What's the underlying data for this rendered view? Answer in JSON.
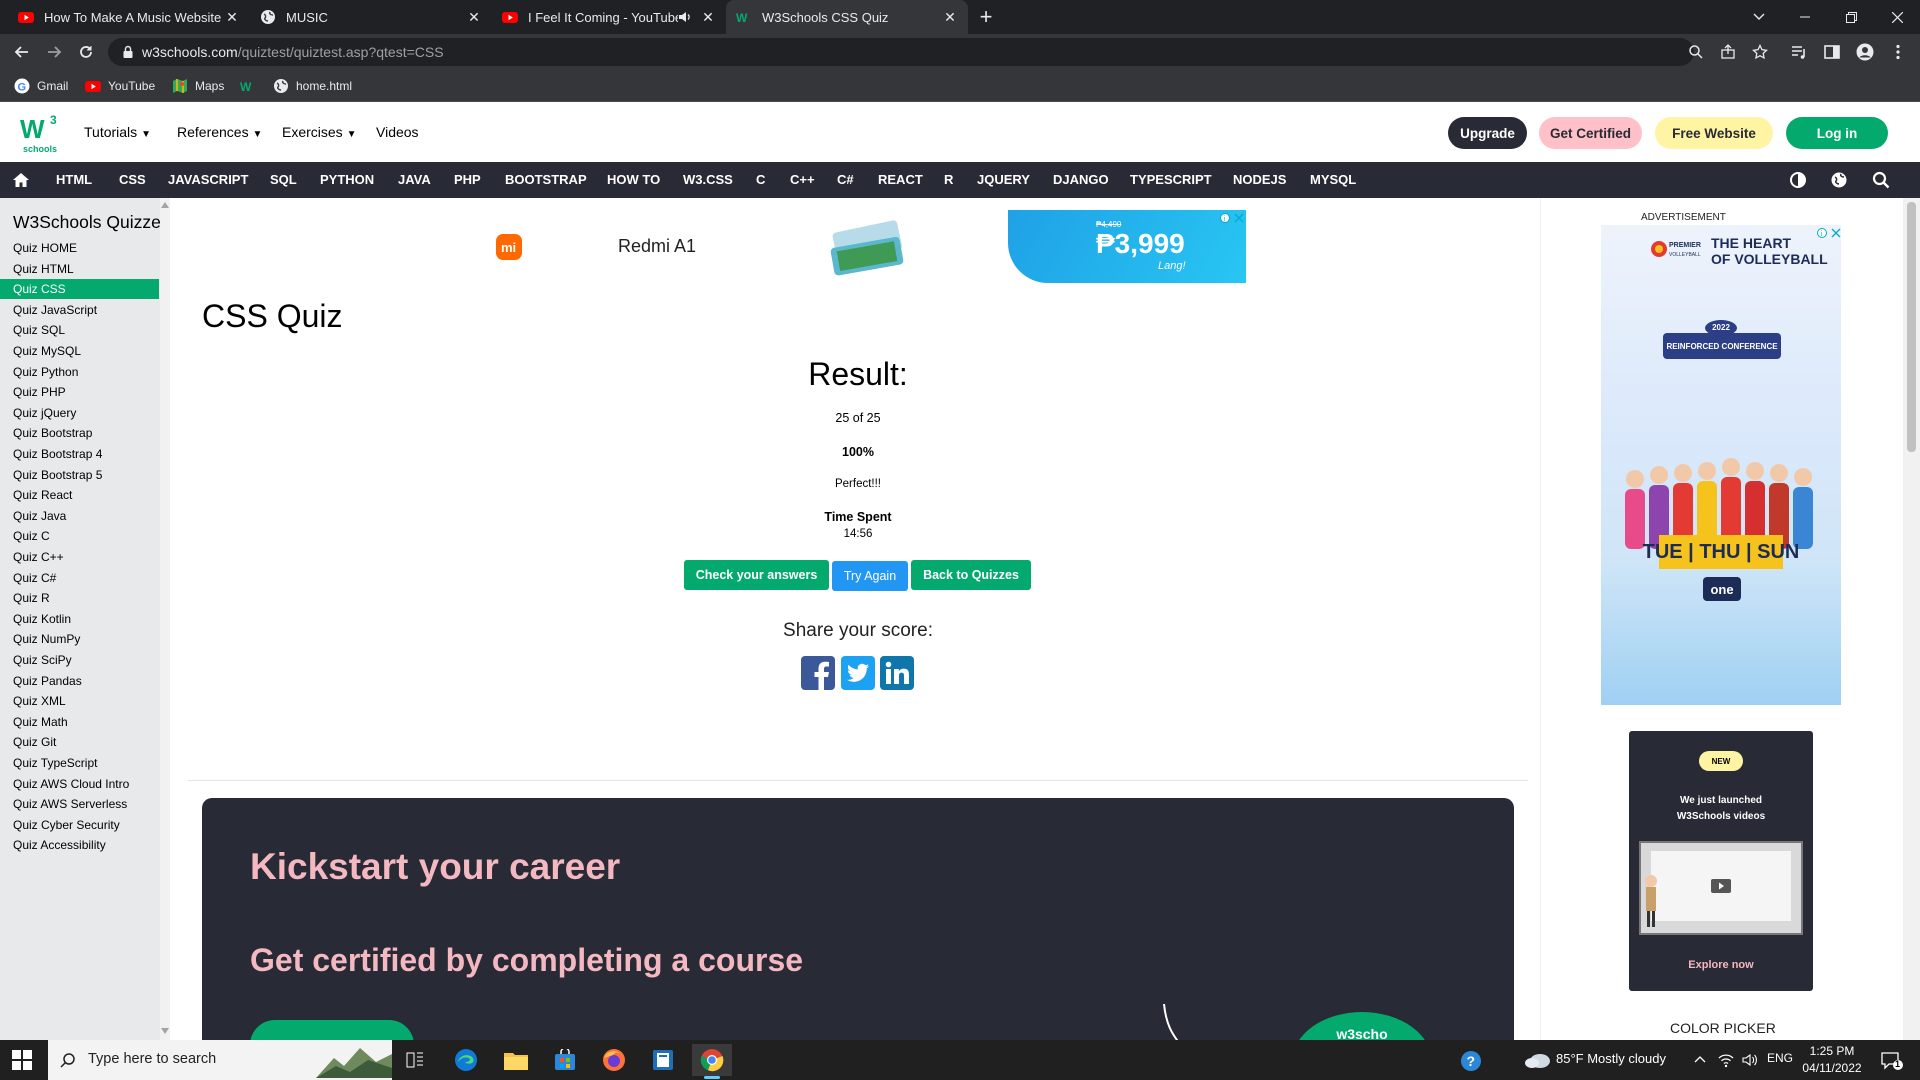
{
  "browser": {
    "tabs": [
      {
        "title": "How To Make A Music Website U",
        "favicon": "youtube-icon"
      },
      {
        "title": "MUSIC",
        "favicon": "globe-icon"
      },
      {
        "title": "I Feel It Coming - YouTube",
        "favicon": "youtube-icon",
        "audio": true
      },
      {
        "title": "W3Schools CSS Quiz",
        "favicon": "w3schools-icon",
        "active": true
      }
    ],
    "url_host": "w3schools.com",
    "url_path": "/quiztest/quiztest.asp?qtest=CSS",
    "bookmarks": [
      "Gmail",
      "YouTube",
      "Maps",
      "",
      "home.html"
    ]
  },
  "header": {
    "logo_text": "schools",
    "menus": [
      "Tutorials",
      "References",
      "Exercises",
      "Videos"
    ],
    "pills": {
      "upgrade": "Upgrade",
      "get_certified": "Get Certified",
      "free_website": "Free Website",
      "login": "Log in"
    },
    "colors": {
      "green": "#04aa6d",
      "dark": "#282a35",
      "pink": "#ffc0c7",
      "yellow": "#fff4a3"
    }
  },
  "topnav": [
    "HTML",
    "CSS",
    "JAVASCRIPT",
    "SQL",
    "PYTHON",
    "JAVA",
    "PHP",
    "BOOTSTRAP",
    "HOW TO",
    "W3.CSS",
    "C",
    "C++",
    "C#",
    "REACT",
    "R",
    "JQUERY",
    "DJANGO",
    "TYPESCRIPT",
    "NODEJS",
    "MYSQL"
  ],
  "sidebar": {
    "title": "W3Schools Quizzes",
    "items": [
      "Quiz HOME",
      "Quiz HTML",
      "Quiz CSS",
      "Quiz JavaScript",
      "Quiz SQL",
      "Quiz MySQL",
      "Quiz Python",
      "Quiz PHP",
      "Quiz jQuery",
      "Quiz Bootstrap",
      "Quiz Bootstrap 4",
      "Quiz Bootstrap 5",
      "Quiz React",
      "Quiz Java",
      "Quiz C",
      "Quiz C++",
      "Quiz C#",
      "Quiz R",
      "Quiz Kotlin",
      "Quiz NumPy",
      "Quiz SciPy",
      "Quiz Pandas",
      "Quiz XML",
      "Quiz Math",
      "Quiz Git",
      "Quiz TypeScript",
      "Quiz AWS Cloud Intro",
      "Quiz AWS Serverless",
      "Quiz Cyber Security",
      "Quiz Accessibility"
    ],
    "active_index": 2
  },
  "ad_banner": {
    "brand": "Redmi A1",
    "old_price": "₱4,490",
    "price": "₱3,999",
    "note": "Lang!"
  },
  "main": {
    "title": "CSS Quiz",
    "result_heading": "Result:",
    "score": "25 of 25",
    "percent": "100%",
    "message": "Perfect!!!",
    "time_label": "Time Spent",
    "time_value": "14:56",
    "buttons": {
      "check": "Check your answers",
      "try": "Try Again",
      "back": "Back to Quizzes"
    },
    "share_label": "Share your score:",
    "share_icons": [
      "facebook-icon",
      "twitter-icon",
      "linkedin-icon"
    ]
  },
  "career": {
    "heading": "Kickstart your career",
    "subheading": "Get certified by completing a course",
    "badge": "w3scho"
  },
  "right": {
    "ad_label": "ADVERTISEMENT",
    "volley": {
      "title1": "THE HEART",
      "title2": "OF VOLLEYBALL",
      "conf_year": "2022",
      "conf": "REINFORCED CONFERENCE",
      "days": "TUE | THU | SUN",
      "brand": "one"
    },
    "promo": {
      "badge": "NEW",
      "line1": "We just launched",
      "line2": "W3Schools videos",
      "link": "Explore now"
    },
    "color_picker": "COLOR PICKER"
  },
  "taskbar": {
    "search_placeholder": "Type here to search",
    "weather": "85°F  Mostly cloudy",
    "lang": "ENG",
    "time": "1:25 PM",
    "date": "04/11/2022",
    "notification_count": "1"
  }
}
